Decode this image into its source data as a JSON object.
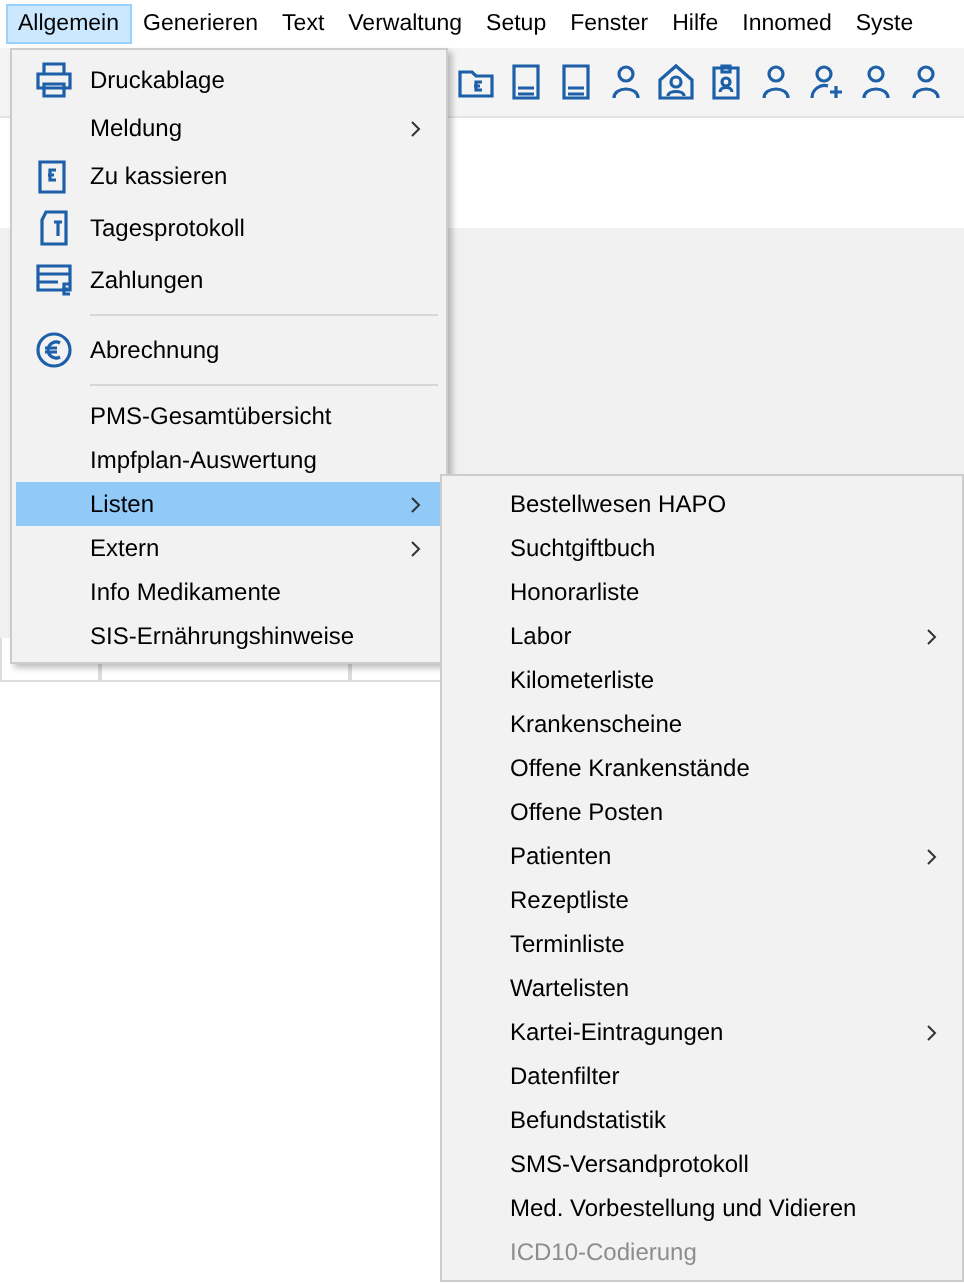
{
  "menu_bar": [
    {
      "label": "Allgemein",
      "selected": true
    },
    {
      "label": "Generieren",
      "selected": false
    },
    {
      "label": "Text",
      "selected": false
    },
    {
      "label": "Verwaltung",
      "selected": false
    },
    {
      "label": "Setup",
      "selected": false
    },
    {
      "label": "Fenster",
      "selected": false
    },
    {
      "label": "Hilfe",
      "selected": false
    },
    {
      "label": "Innomed",
      "selected": false
    },
    {
      "label": "Syste",
      "selected": false
    }
  ],
  "menu": {
    "items": [
      {
        "kind": "item",
        "label": "Druckablage",
        "has_submenu": false,
        "selected": false
      },
      {
        "kind": "item",
        "label": "Meldung",
        "has_submenu": true,
        "selected": false
      },
      {
        "kind": "item",
        "label": "Zu kassieren",
        "has_submenu": false,
        "selected": false
      },
      {
        "kind": "item",
        "label": "Tagesprotokoll",
        "has_submenu": false,
        "selected": false
      },
      {
        "kind": "item",
        "label": "Zahlungen",
        "has_submenu": false,
        "selected": false
      },
      {
        "kind": "separator"
      },
      {
        "kind": "item",
        "label": "Abrechnung",
        "has_submenu": false,
        "selected": false
      },
      {
        "kind": "separator"
      },
      {
        "kind": "item",
        "label": "PMS-Gesamtübersicht",
        "has_submenu": false,
        "selected": false
      },
      {
        "kind": "item",
        "label": "Impfplan-Auswertung",
        "has_submenu": false,
        "selected": false
      },
      {
        "kind": "item",
        "label": "Listen",
        "has_submenu": true,
        "selected": true
      },
      {
        "kind": "item",
        "label": "Extern",
        "has_submenu": true,
        "selected": false
      },
      {
        "kind": "item",
        "label": "Info Medikamente",
        "has_submenu": false,
        "selected": false
      },
      {
        "kind": "item",
        "label": "SIS-Ernährungshinweise",
        "has_submenu": false,
        "selected": false
      }
    ]
  },
  "submenu": {
    "items": [
      {
        "label": "Bestellwesen HAPO",
        "has_submenu": false,
        "disabled": false
      },
      {
        "label": "Suchtgiftbuch",
        "has_submenu": false,
        "disabled": false
      },
      {
        "label": "Honorarliste",
        "has_submenu": false,
        "disabled": false
      },
      {
        "label": "Labor",
        "has_submenu": true,
        "disabled": false
      },
      {
        "label": "Kilometerliste",
        "has_submenu": false,
        "disabled": false
      },
      {
        "label": "Krankenscheine",
        "has_submenu": false,
        "disabled": false
      },
      {
        "label": "Offene Krankenstände",
        "has_submenu": false,
        "disabled": false
      },
      {
        "label": "Offene Posten",
        "has_submenu": false,
        "disabled": false
      },
      {
        "label": "Patienten",
        "has_submenu": true,
        "disabled": false
      },
      {
        "label": "Rezeptliste",
        "has_submenu": false,
        "disabled": false
      },
      {
        "label": "Terminliste",
        "has_submenu": false,
        "disabled": false
      },
      {
        "label": "Wartelisten",
        "has_submenu": false,
        "disabled": false
      },
      {
        "label": "Kartei-Eintragungen",
        "has_submenu": true,
        "disabled": false
      },
      {
        "label": "Datenfilter",
        "has_submenu": false,
        "disabled": false
      },
      {
        "label": "Befundstatistik",
        "has_submenu": false,
        "disabled": false
      },
      {
        "label": "SMS-Versandprotokoll",
        "has_submenu": false,
        "disabled": false
      },
      {
        "label": "Med. Vorbestellung und Vidieren",
        "has_submenu": false,
        "disabled": false
      },
      {
        "label": "ICD10-Codierung",
        "has_submenu": false,
        "disabled": true
      }
    ]
  }
}
